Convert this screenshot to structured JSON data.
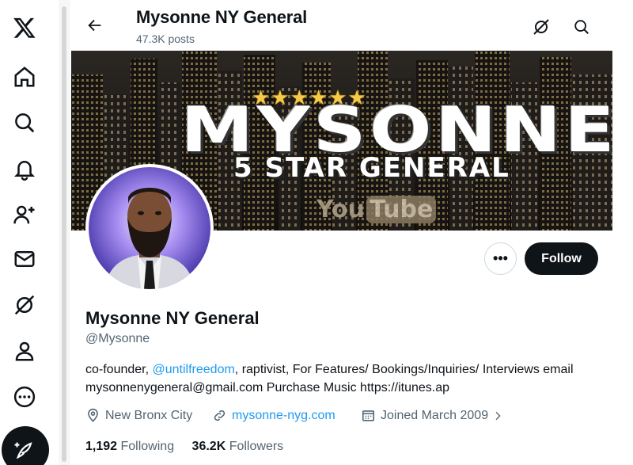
{
  "nav": {
    "items": [
      {
        "icon": "x-logo-icon"
      },
      {
        "icon": "home-icon"
      },
      {
        "icon": "explore-icon"
      },
      {
        "icon": "notifications-icon"
      },
      {
        "icon": "follow-icon"
      },
      {
        "icon": "messages-icon"
      },
      {
        "icon": "grok-icon"
      },
      {
        "icon": "profile-icon"
      },
      {
        "icon": "more-icon"
      }
    ],
    "compose_icon": "compose-post-icon"
  },
  "header": {
    "name": "Mysonne NY General",
    "posts": "47.3K posts"
  },
  "banner": {
    "stars": "★★★★★★",
    "title": "MYSONNE",
    "subtitle": "5 STAR GENERAL",
    "logo_you": "You",
    "logo_tube": "Tube"
  },
  "actions": {
    "more_label": "•••",
    "follow_label": "Follow"
  },
  "profile": {
    "display_name": "Mysonne NY General",
    "handle": "@Mysonne",
    "bio_prefix": "co-founder, ",
    "bio_mention": "@untilfreedom",
    "bio_suffix": ", raptivist, For Features/ Bookings/Inquiries/ Interviews email mysonnenygeneral@gmail.com Purchase Music https://itunes.ap",
    "location": "New Bronx City",
    "website": "mysonne-nyg.com",
    "joined": "Joined March 2009",
    "following_count": "1,192",
    "following_label": "Following",
    "followers_count": "36.2K",
    "followers_label": "Followers"
  },
  "colors": {
    "accent": "#1d9bf0",
    "text": "#0f1419",
    "secondary": "#536471",
    "button_dark": "#0f1419"
  }
}
